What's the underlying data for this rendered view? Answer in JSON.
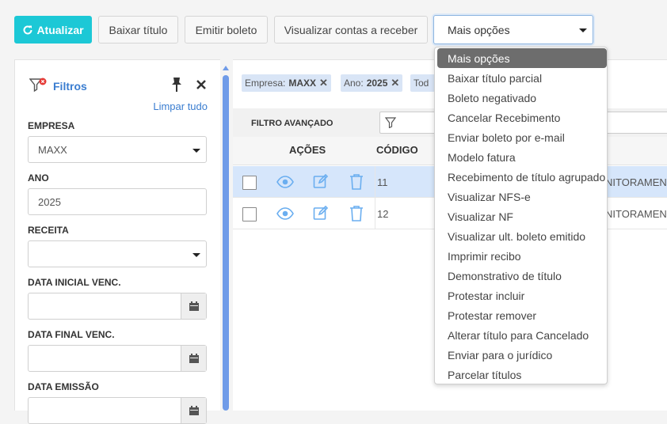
{
  "toolbar": {
    "refresh_label": "Atualizar",
    "download_label": "Baixar título",
    "issue_label": "Emitir boleto",
    "view_label": "Visualizar contas a receber",
    "more_options_value": "Mais opções"
  },
  "dropdown": {
    "options": [
      "Mais opções",
      "Baixar título parcial",
      "Boleto negativado",
      "Cancelar Recebimento",
      "Enviar boleto por e-mail",
      "Modelo fatura",
      "Recebimento de título agrupado",
      "Visualizar NFS-e",
      "Visualizar NF",
      "Visualizar ult. boleto emitido",
      "Imprimir recibo",
      "Demonstrativo de título",
      "Protestar incluir",
      "Protestar remover",
      "Alterar título para Cancelado",
      "Enviar para o jurídico",
      "Parcelar títulos"
    ]
  },
  "sidebar": {
    "title": "Filtros",
    "clear_all": "Limpar tudo",
    "empresa_label": "EMPRESA",
    "empresa_value": "MAXX",
    "ano_label": "ANO",
    "ano_value": "2025",
    "receita_label": "RECEITA",
    "data_inicial_label": "DATA INICIAL VENC.",
    "data_final_label": "DATA FINAL VENC.",
    "data_emissao_label": "DATA EMISSÃO"
  },
  "chips": [
    {
      "label": "Empresa:",
      "value": "MAXX"
    },
    {
      "label": "Ano:",
      "value": "2025"
    },
    {
      "label": "Tod"
    }
  ],
  "table": {
    "advanced_filter_label": "FILTRO AVANÇADO",
    "headers": {
      "actions": "AÇÕES",
      "code": "CÓDIGO"
    },
    "rows": [
      {
        "code": "11",
        "trailing": "NITORAMENT"
      },
      {
        "code": "12",
        "trailing": "NITORAMENT"
      }
    ]
  },
  "colors": {
    "primary": "#1cc8d6",
    "accent": "#3a7dd0",
    "row_selected": "#d6e6fb",
    "icon": "#6aaef0"
  }
}
